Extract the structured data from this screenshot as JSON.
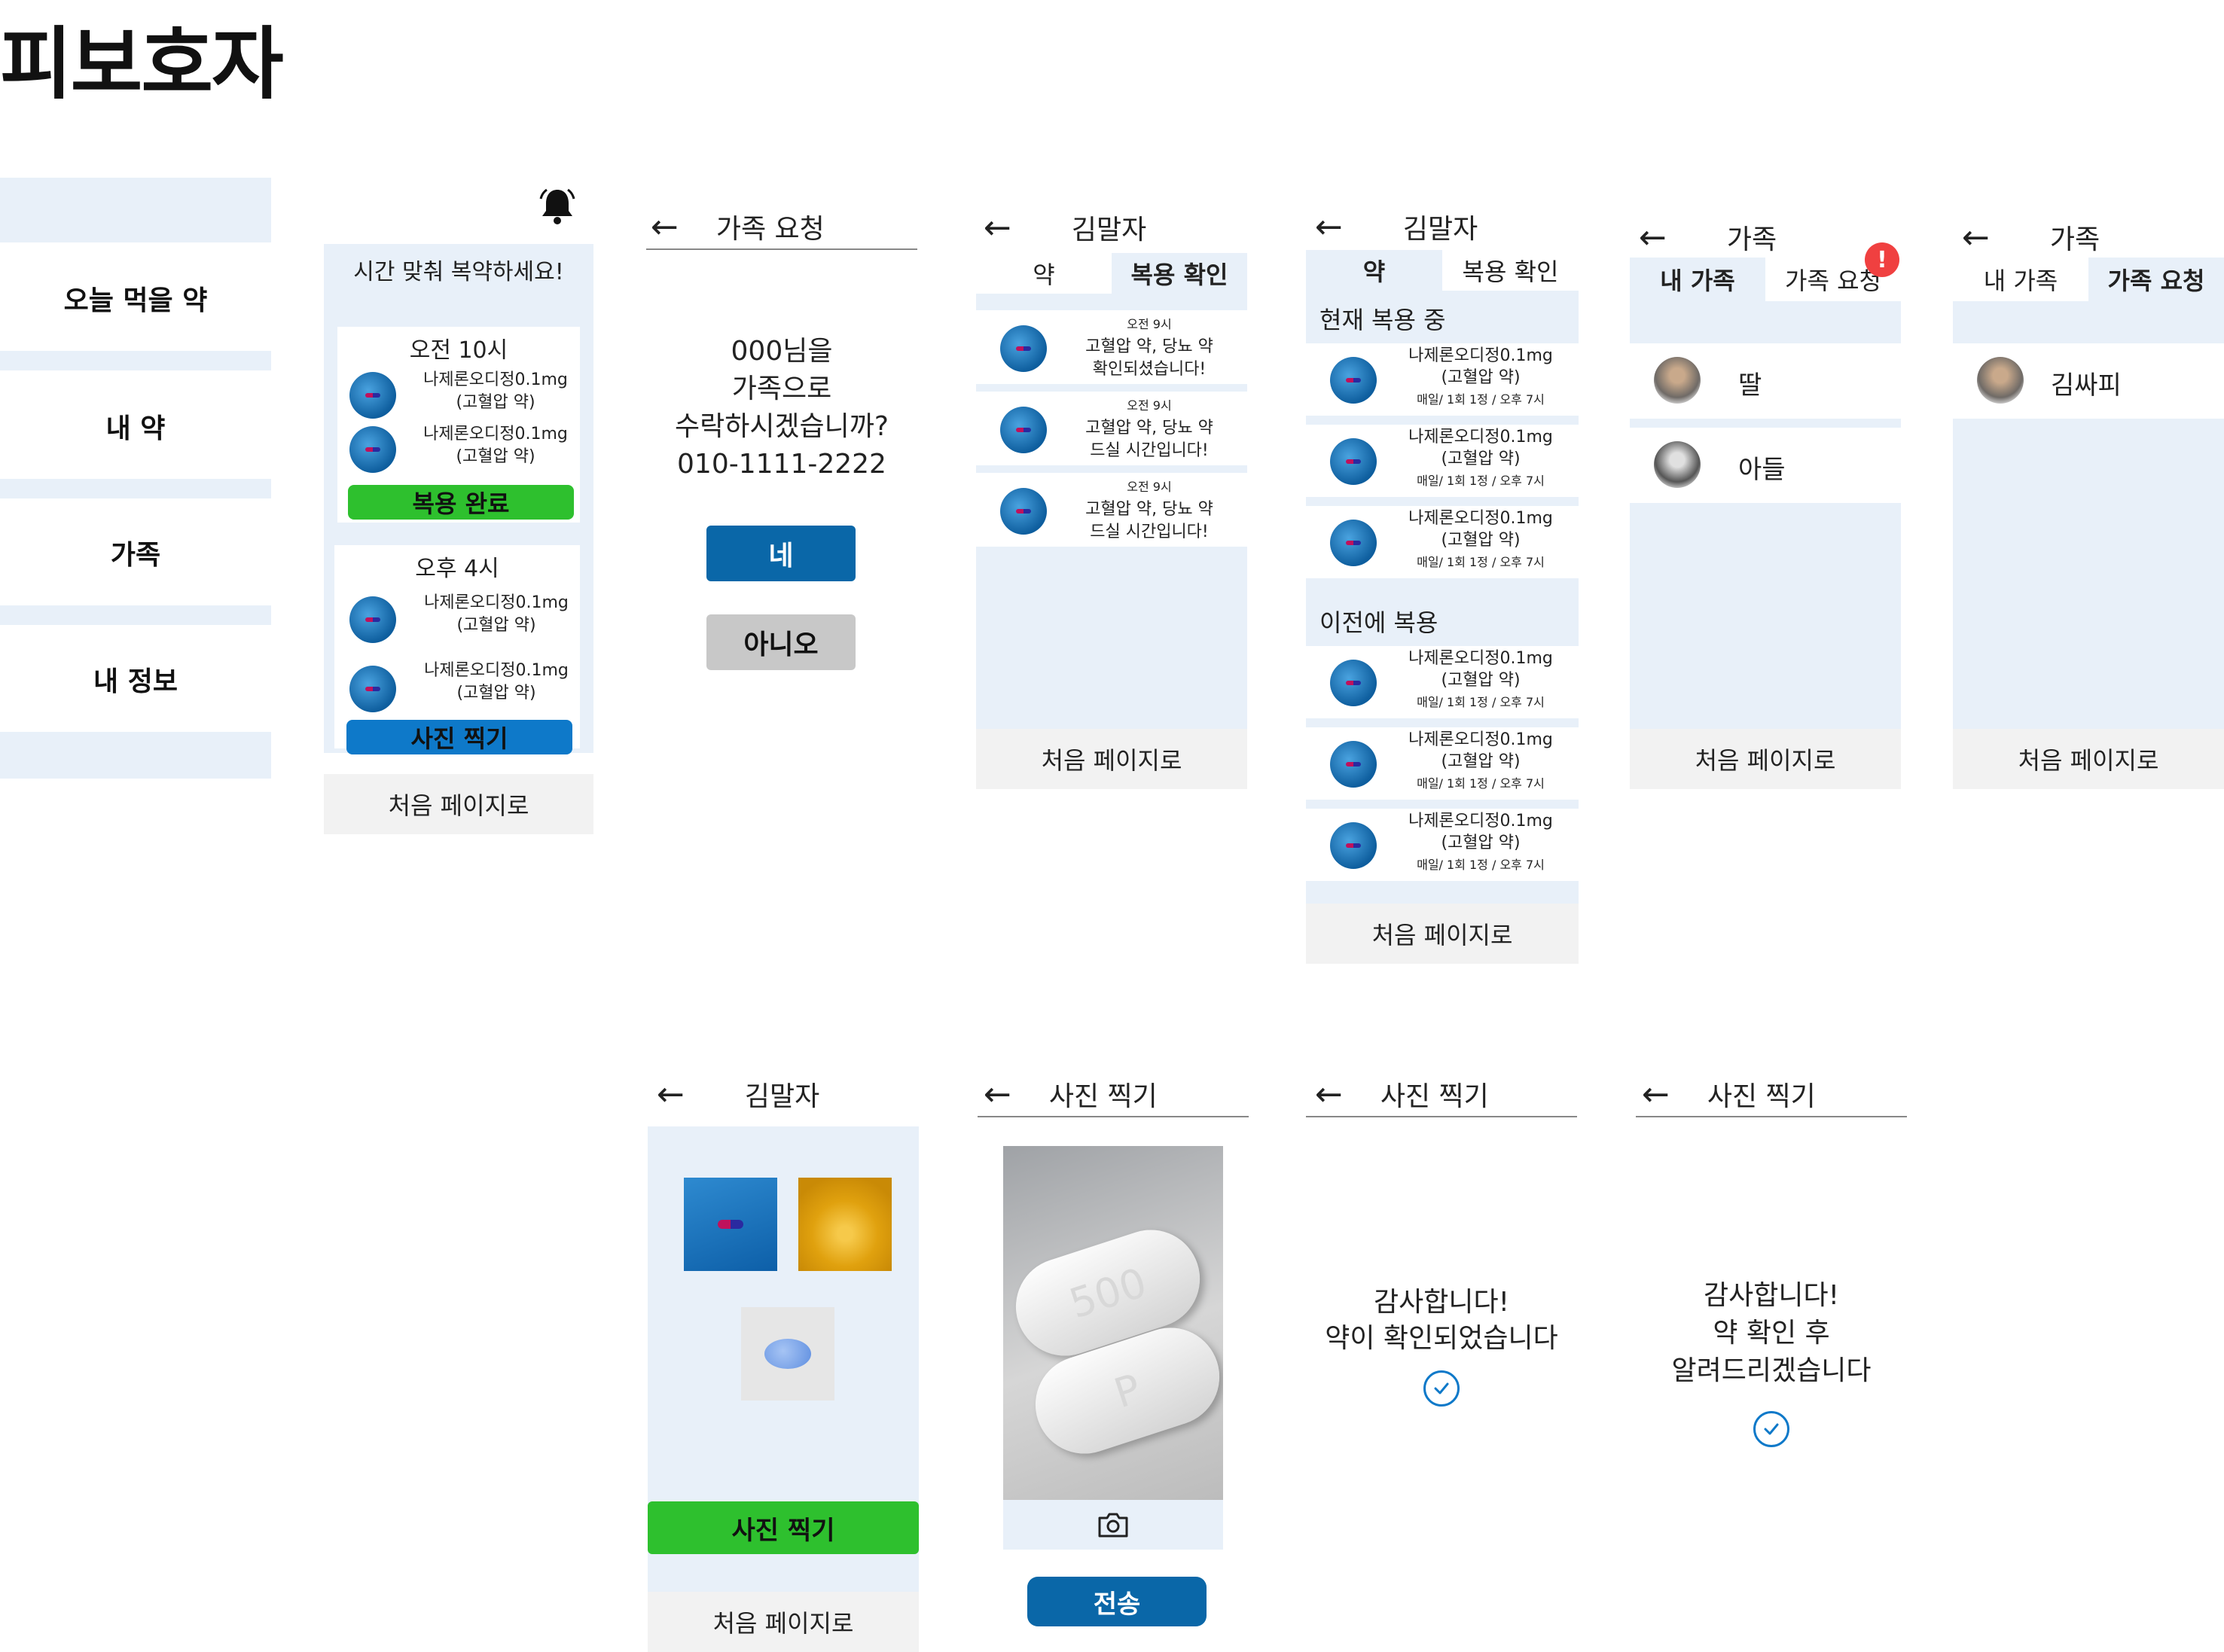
{
  "page_title": "피보호자",
  "menu": {
    "items": [
      {
        "label": "오늘 먹을 약"
      },
      {
        "label": "내 약"
      },
      {
        "label": "가족"
      },
      {
        "label": "내 정보"
      }
    ]
  },
  "home": {
    "banner": "시간 맞춰 복약하세요!",
    "slot1": {
      "time": "오전 10시",
      "meds": [
        {
          "name": "나제론오디정0.1mg",
          "desc": "(고혈압 약)"
        },
        {
          "name": "나제론오디정0.1mg",
          "desc": "(고혈압 약)"
        }
      ],
      "button": "복용 완료"
    },
    "slot2": {
      "time": "오후 4시",
      "meds": [
        {
          "name": "나제론오디정0.1mg",
          "desc": "(고혈압 약)"
        },
        {
          "name": "나제론오디정0.1mg",
          "desc": "(고혈압 약)"
        }
      ],
      "button": "사진 찍기"
    },
    "footer": "처음 페이지로"
  },
  "family_request": {
    "title": "가족 요청",
    "question_lines": [
      "000님을",
      "가족으로",
      "수락하시겠습니까?",
      "010-1111-2222"
    ],
    "yes": "네",
    "no": "아니오"
  },
  "check_screen": {
    "title": "김말자",
    "tab_meds": "약",
    "tab_check": "복용 확인",
    "items": [
      {
        "time": "오전 9시",
        "line1": "고혈압 약, 당뇨 약",
        "line2": "확인되셨습니다!"
      },
      {
        "time": "오전 9시",
        "line1": "고혈압 약, 당뇨 약",
        "line2": "드실 시간입니다!"
      },
      {
        "time": "오전 9시",
        "line1": "고혈압 약, 당뇨 약",
        "line2": "드실 시간입니다!"
      }
    ],
    "footer": "처음 페이지로"
  },
  "meds_screen": {
    "title": "김말자",
    "tab_meds": "약",
    "tab_check": "복용 확인",
    "current_header": "현재 복용 중",
    "previous_header": "이전에 복용",
    "med": {
      "name": "나제론오디정0.1mg",
      "desc": "(고혈압 약)",
      "schedule": "매일/ 1회 1정 / 오후 7시"
    },
    "footer": "처음 페이지로"
  },
  "family_mine": {
    "title": "가족",
    "tab_mine": "내 가족",
    "tab_requests": "가족 요청",
    "badge": "!",
    "members": [
      {
        "name": "딸"
      },
      {
        "name": "아들"
      }
    ],
    "footer": "처음 페이지로"
  },
  "family_requests": {
    "title": "가족",
    "tab_mine": "내 가족",
    "tab_requests": "가족 요청",
    "requests": [
      {
        "name": "김싸피"
      }
    ],
    "footer": "처음 페이지로"
  },
  "photo_gallery": {
    "title": "김말자",
    "button": "사진 찍기",
    "footer": "처음 페이지로"
  },
  "photo_capture": {
    "title": "사진 찍기",
    "pill_text_top": "500",
    "pill_text_bottom": "P",
    "send": "전송"
  },
  "thanks_confirmed": {
    "title": "사진 찍기",
    "lines": [
      "감사합니다!",
      "약이 확인되었습니다"
    ]
  },
  "thanks_pending": {
    "title": "사진 찍기",
    "lines": [
      "감사합니다!",
      "약 확인 후",
      "알려드리겠습니다"
    ]
  },
  "colors": {
    "screen_bg": "#e8f0f9",
    "green": "#2ec02e",
    "blue": "#0e79c9",
    "dark_blue": "#0a67a8",
    "badge_red": "#f04040"
  }
}
